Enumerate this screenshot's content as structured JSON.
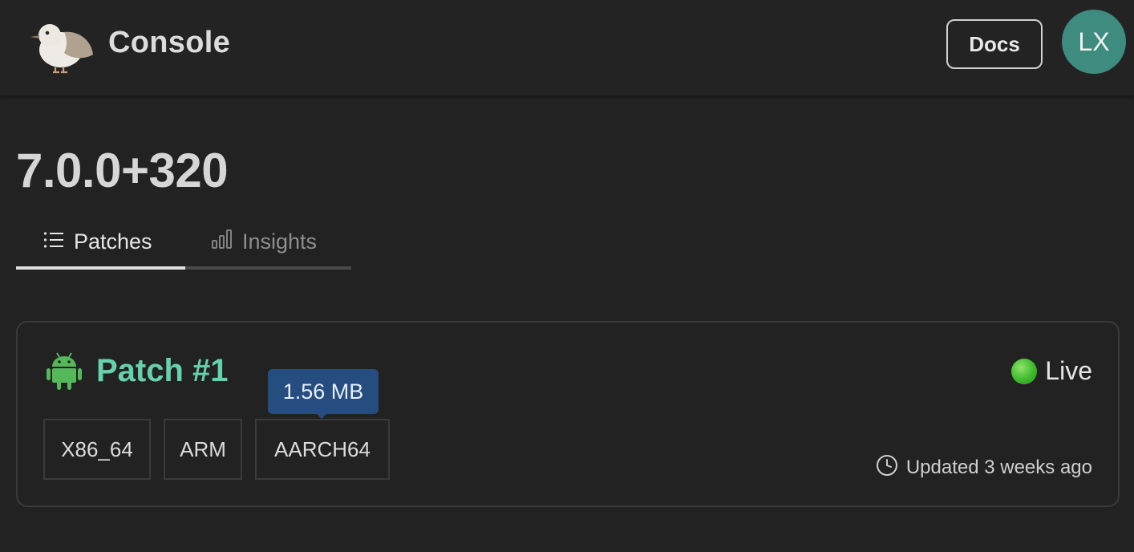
{
  "header": {
    "title": "Console",
    "docs_label": "Docs",
    "avatar_initials": "LX",
    "avatar_color": "#3e8b80"
  },
  "page": {
    "title": "7.0.0+320"
  },
  "tabs": [
    {
      "label": "Patches",
      "icon": "list-icon",
      "active": true
    },
    {
      "label": "Insights",
      "icon": "bar-chart-icon",
      "active": false
    }
  ],
  "patch": {
    "title": "Patch #1",
    "platform_icon": "android-icon",
    "title_color": "#66d1ad",
    "status": "Live",
    "status_color": "#3dba2c",
    "architectures": [
      "X86_64",
      "ARM",
      "AARCH64"
    ],
    "tooltip": "1.56 MB",
    "updated": "Updated 3 weeks ago"
  }
}
